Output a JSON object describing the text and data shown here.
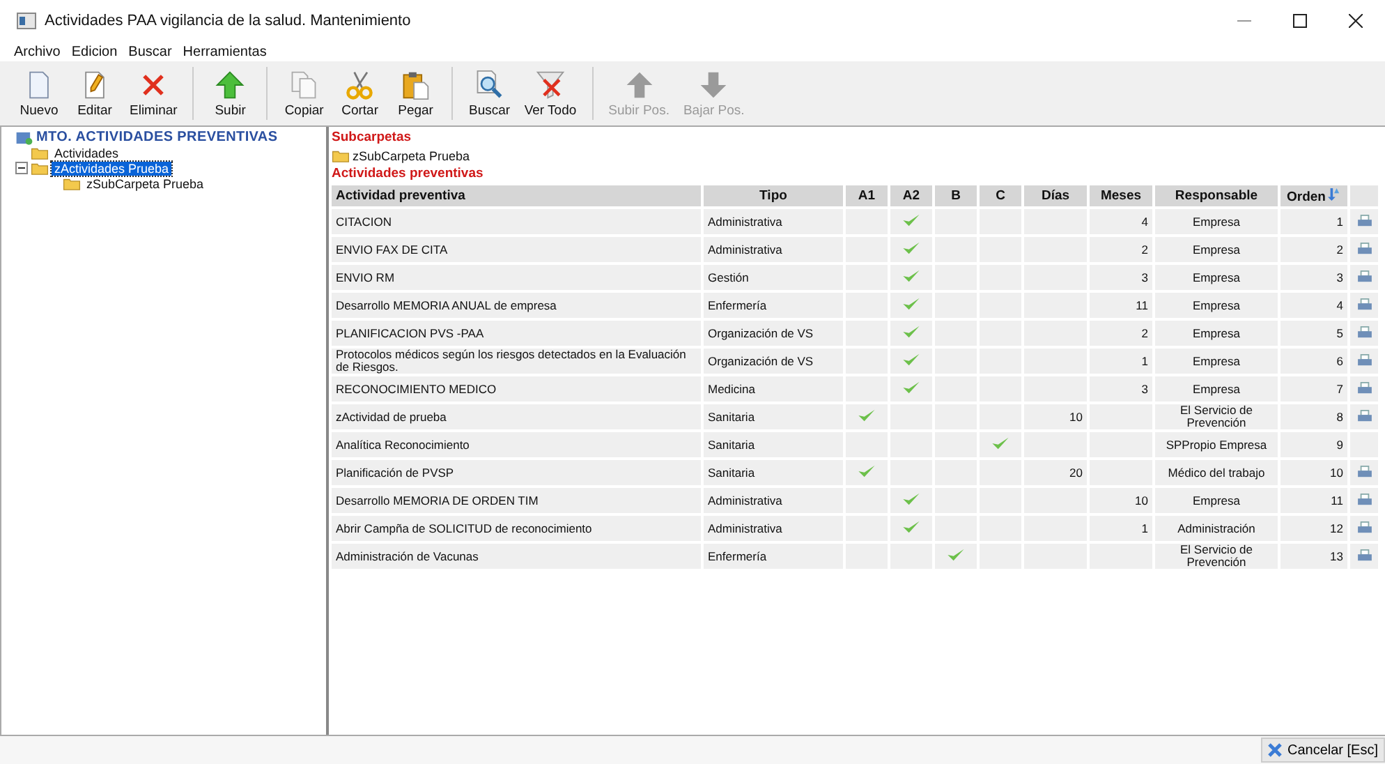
{
  "window": {
    "title": "Actividades PAA vigilancia de la salud. Mantenimiento"
  },
  "menu": [
    "Archivo",
    "Edicion",
    "Buscar",
    "Herramientas"
  ],
  "toolbar": [
    {
      "kind": "new",
      "label": "Nuevo",
      "disabled": false
    },
    {
      "kind": "edit",
      "label": "Editar",
      "disabled": false
    },
    {
      "kind": "delete",
      "label": "Eliminar",
      "disabled": false
    },
    {
      "kind": "sep"
    },
    {
      "kind": "up",
      "label": "Subir",
      "disabled": false
    },
    {
      "kind": "sep"
    },
    {
      "kind": "copy",
      "label": "Copiar",
      "disabled": false
    },
    {
      "kind": "cut",
      "label": "Cortar",
      "disabled": false
    },
    {
      "kind": "paste",
      "label": "Pegar",
      "disabled": false
    },
    {
      "kind": "sep"
    },
    {
      "kind": "find",
      "label": "Buscar",
      "disabled": false
    },
    {
      "kind": "filter",
      "label": "Ver Todo",
      "disabled": false
    },
    {
      "kind": "sep"
    },
    {
      "kind": "moveup",
      "label": "Subir Pos.",
      "disabled": true
    },
    {
      "kind": "movedown",
      "label": "Bajar Pos.",
      "disabled": true
    }
  ],
  "tree": {
    "root": "MTO. ACTIVIDADES PREVENTIVAS",
    "children": [
      {
        "label": "Actividades",
        "selected": false
      },
      {
        "label": "zActividades Prueba",
        "selected": true,
        "expanded": true,
        "children": [
          {
            "label": "zSubCarpeta Prueba",
            "selected": false
          }
        ]
      }
    ]
  },
  "subfolders": {
    "title": "Subcarpetas",
    "items": [
      "zSubCarpeta Prueba"
    ]
  },
  "table": {
    "title": "Actividades preventivas",
    "columns": [
      "Actividad preventiva",
      "Tipo",
      "A1",
      "A2",
      "B",
      "C",
      "Días",
      "Meses",
      "Responsable",
      "Orden"
    ],
    "rows": [
      {
        "name": "CITACION",
        "tipo": "Administrativa",
        "a1": false,
        "a2": true,
        "b": false,
        "c": false,
        "dias": "",
        "meses": "4",
        "responsable": "Empresa",
        "orden": "1",
        "print": true
      },
      {
        "name": "ENVIO FAX DE CITA",
        "tipo": "Administrativa",
        "a1": false,
        "a2": true,
        "b": false,
        "c": false,
        "dias": "",
        "meses": "2",
        "responsable": "Empresa",
        "orden": "2",
        "print": true
      },
      {
        "name": "ENVIO RM",
        "tipo": "Gestión",
        "a1": false,
        "a2": true,
        "b": false,
        "c": false,
        "dias": "",
        "meses": "3",
        "responsable": "Empresa",
        "orden": "3",
        "print": true
      },
      {
        "name": "Desarrollo MEMORIA ANUAL de empresa",
        "tipo": "Enfermería",
        "a1": false,
        "a2": true,
        "b": false,
        "c": false,
        "dias": "",
        "meses": "11",
        "responsable": "Empresa",
        "orden": "4",
        "print": true
      },
      {
        "name": "PLANIFICACION PVS -PAA",
        "tipo": "Organización de VS",
        "a1": false,
        "a2": true,
        "b": false,
        "c": false,
        "dias": "",
        "meses": "2",
        "responsable": "Empresa",
        "orden": "5",
        "print": true
      },
      {
        "name": "Protocolos médicos según los riesgos detectados en la Evaluación de Riesgos.",
        "tipo": "Organización de VS",
        "a1": false,
        "a2": true,
        "b": false,
        "c": false,
        "dias": "",
        "meses": "1",
        "responsable": "Empresa",
        "orden": "6",
        "print": true
      },
      {
        "name": "RECONOCIMIENTO MEDICO",
        "tipo": "Medicina",
        "a1": false,
        "a2": true,
        "b": false,
        "c": false,
        "dias": "",
        "meses": "3",
        "responsable": "Empresa",
        "orden": "7",
        "print": true
      },
      {
        "name": "zActividad de prueba",
        "tipo": "Sanitaria",
        "a1": true,
        "a2": false,
        "b": false,
        "c": false,
        "dias": "10",
        "meses": "",
        "responsable": "El Servicio de Prevención",
        "orden": "8",
        "print": true
      },
      {
        "name": "Analítica Reconocimiento",
        "tipo": "Sanitaria",
        "a1": false,
        "a2": false,
        "b": false,
        "c": true,
        "dias": "",
        "meses": "",
        "responsable": "SPPropio Empresa",
        "orden": "9",
        "print": false
      },
      {
        "name": "Planificación de PVSP",
        "tipo": "Sanitaria",
        "a1": true,
        "a2": false,
        "b": false,
        "c": false,
        "dias": "20",
        "meses": "",
        "responsable": "Médico del trabajo",
        "orden": "10",
        "print": true
      },
      {
        "name": "Desarrollo MEMORIA DE ORDEN TIM",
        "tipo": "Administrativa",
        "a1": false,
        "a2": true,
        "b": false,
        "c": false,
        "dias": "",
        "meses": "10",
        "responsable": "Empresa",
        "orden": "11",
        "print": true
      },
      {
        "name": "Abrir Campña de SOLICITUD de reconocimiento",
        "tipo": "Administrativa",
        "a1": false,
        "a2": true,
        "b": false,
        "c": false,
        "dias": "",
        "meses": "1",
        "responsable": "Administración",
        "orden": "12",
        "print": true
      },
      {
        "name": "Administración de Vacunas",
        "tipo": "Enfermería",
        "a1": false,
        "a2": false,
        "b": true,
        "c": false,
        "dias": "",
        "meses": "",
        "responsable": "El Servicio de Prevención",
        "orden": "13",
        "print": true
      }
    ]
  },
  "cancel_button": {
    "label": "Cancelar [Esc]"
  }
}
